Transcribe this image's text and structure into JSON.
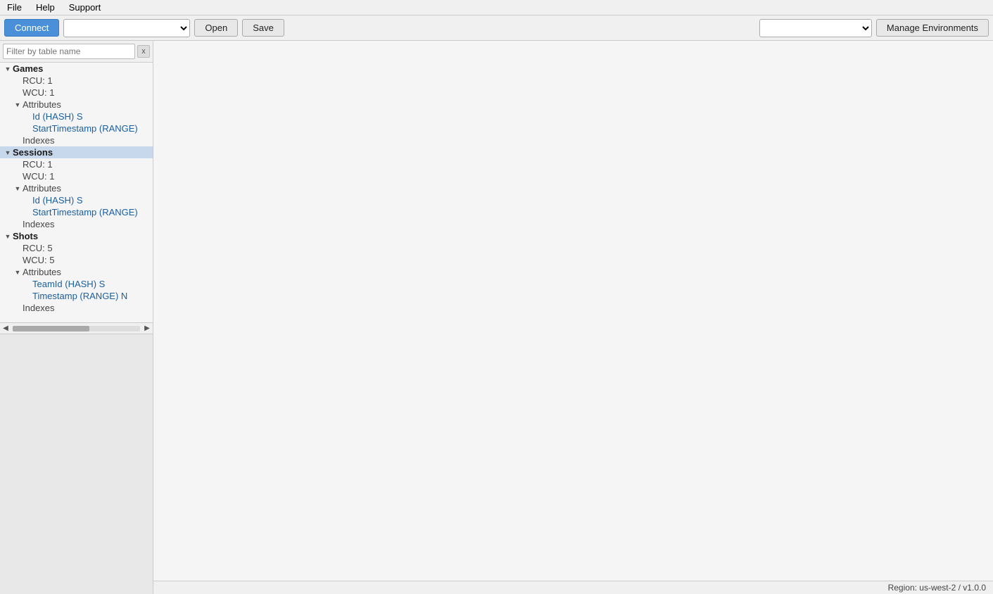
{
  "menubar": {
    "file": "File",
    "help": "Help",
    "support": "Support"
  },
  "toolbar": {
    "connect_label": "Connect",
    "open_label": "Open",
    "save_label": "Save",
    "manage_env_label": "Manage Environments",
    "query_placeholder": "",
    "env_placeholder": ""
  },
  "sidebar": {
    "filter_placeholder": "Filter by table name",
    "filter_clear": "x"
  },
  "tree": {
    "items": [
      {
        "id": "games",
        "level": 0,
        "expand": "▼",
        "label": "Games",
        "type": "table"
      },
      {
        "id": "games-rcu",
        "level": 1,
        "expand": "",
        "label": "RCU: 1",
        "type": "info"
      },
      {
        "id": "games-wcu",
        "level": 1,
        "expand": "",
        "label": "WCU: 1",
        "type": "info"
      },
      {
        "id": "games-attributes",
        "level": 1,
        "expand": "▼",
        "label": "Attributes",
        "type": "section"
      },
      {
        "id": "games-attr-id",
        "level": 2,
        "expand": "",
        "label": "Id (HASH) S",
        "type": "attribute"
      },
      {
        "id": "games-attr-ts",
        "level": 2,
        "expand": "",
        "label": "StartTimestamp (RANGE)",
        "type": "attribute"
      },
      {
        "id": "games-indexes",
        "level": 1,
        "expand": "",
        "label": "Indexes",
        "type": "section"
      },
      {
        "id": "sessions",
        "level": 0,
        "expand": "▼",
        "label": "Sessions",
        "type": "table",
        "selected": true
      },
      {
        "id": "sessions-rcu",
        "level": 1,
        "expand": "",
        "label": "RCU: 1",
        "type": "info"
      },
      {
        "id": "sessions-wcu",
        "level": 1,
        "expand": "",
        "label": "WCU: 1",
        "type": "info"
      },
      {
        "id": "sessions-attributes",
        "level": 1,
        "expand": "▼",
        "label": "Attributes",
        "type": "section"
      },
      {
        "id": "sessions-attr-id",
        "level": 2,
        "expand": "",
        "label": "Id (HASH) S",
        "type": "attribute"
      },
      {
        "id": "sessions-attr-ts",
        "level": 2,
        "expand": "",
        "label": "StartTimestamp (RANGE)",
        "type": "attribute"
      },
      {
        "id": "sessions-indexes",
        "level": 1,
        "expand": "",
        "label": "Indexes",
        "type": "section"
      },
      {
        "id": "shots",
        "level": 0,
        "expand": "▼",
        "label": "Shots",
        "type": "table"
      },
      {
        "id": "shots-rcu",
        "level": 1,
        "expand": "",
        "label": "RCU: 5",
        "type": "info"
      },
      {
        "id": "shots-wcu",
        "level": 1,
        "expand": "",
        "label": "WCU: 5",
        "type": "info"
      },
      {
        "id": "shots-attributes",
        "level": 1,
        "expand": "▼",
        "label": "Attributes",
        "type": "section"
      },
      {
        "id": "shots-attr-teamid",
        "level": 2,
        "expand": "",
        "label": "TeamId (HASH) S",
        "type": "attribute"
      },
      {
        "id": "shots-attr-timestamp",
        "level": 2,
        "expand": "",
        "label": "Timestamp (RANGE) N",
        "type": "attribute"
      },
      {
        "id": "shots-indexes",
        "level": 1,
        "expand": "",
        "label": "Indexes",
        "type": "section"
      }
    ]
  },
  "statusbar": {
    "region": "Region: us-west-2 / v1.0.0"
  }
}
